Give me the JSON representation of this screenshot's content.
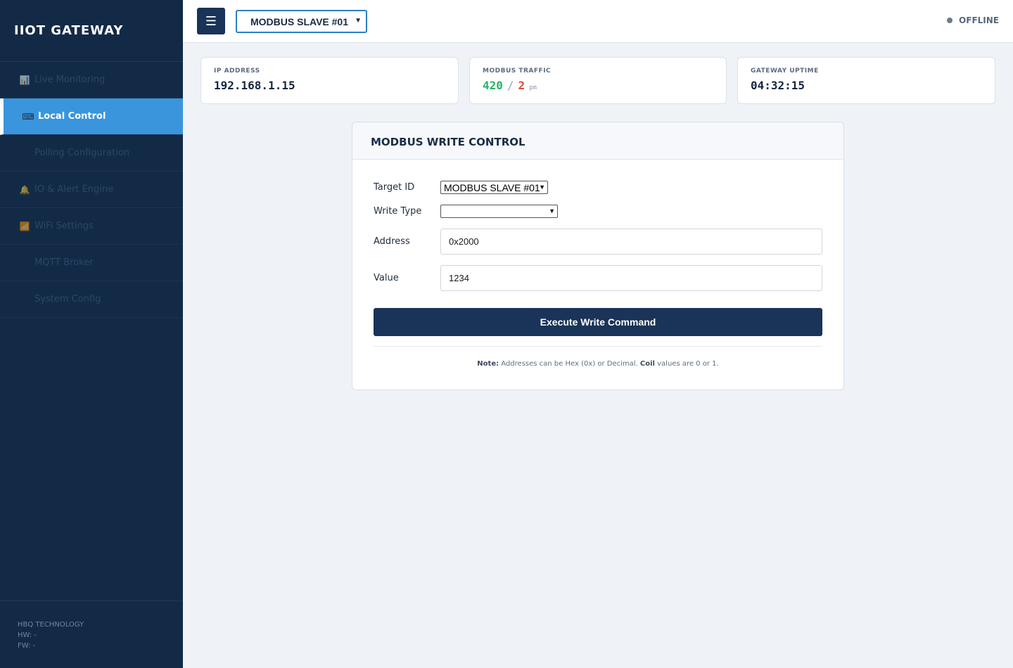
{
  "sidebar": {
    "brand": "IIOT GATEWAY",
    "items": [
      {
        "label": "Live Monitoring",
        "icon": "📊",
        "icon_name": "chart-icon",
        "active": false
      },
      {
        "label": "Local Control",
        "icon": "⌨",
        "icon_name": "keyboard-icon",
        "active": true
      },
      {
        "label": "Polling Configuration",
        "icon": "⚙",
        "icon_name": "gear-icon",
        "active": false
      },
      {
        "label": "IO & Alert Engine",
        "icon": "🔔",
        "icon_name": "bell-icon",
        "active": false
      },
      {
        "label": "WiFi Settings",
        "icon": "📶",
        "icon_name": "wifi-icon",
        "active": false
      },
      {
        "label": "MQTT Broker",
        "icon": "☁",
        "icon_name": "cloud-icon",
        "active": false
      },
      {
        "label": "System Config",
        "icon": "🛠",
        "icon_name": "tools-icon",
        "active": false
      }
    ],
    "footer": {
      "company": "HBQ TECHNOLOGY",
      "hw": "HW: -",
      "fw": "FW: -"
    }
  },
  "header": {
    "menu_icon": "☰",
    "slave_select": "MODBUS SLAVE #01",
    "status": "OFFLINE"
  },
  "stats": {
    "ip": {
      "label": "IP ADDRESS",
      "value": "192.168.1.15"
    },
    "traffic": {
      "label": "MODBUS TRAFFIC",
      "ok": "420",
      "sep": "/",
      "err": "2",
      "unit": "pm"
    },
    "uptime": {
      "label": "GATEWAY UPTIME",
      "value": "04:32:15"
    }
  },
  "panel": {
    "title": "MODBUS WRITE CONTROL",
    "target_label": "Target ID",
    "target_value": "MODBUS SLAVE #01",
    "write_type_label": "Write Type",
    "write_type_value": "",
    "address_label": "Address",
    "address_value": "0x2000",
    "value_label": "Value",
    "value_value": "1234",
    "button": "Execute Write Command",
    "note": {
      "prefix": "Note:",
      "text1": " Addresses can be Hex (0x) or Decimal. ",
      "coil": "Coil",
      "text2": " values are 0 or 1."
    }
  },
  "colors": {
    "sidebar_bg": "#132a46",
    "active_item": "#3a95dd",
    "primary_button": "#1a3358",
    "ok_green": "#2ab367",
    "error_red": "#e04b3c"
  }
}
